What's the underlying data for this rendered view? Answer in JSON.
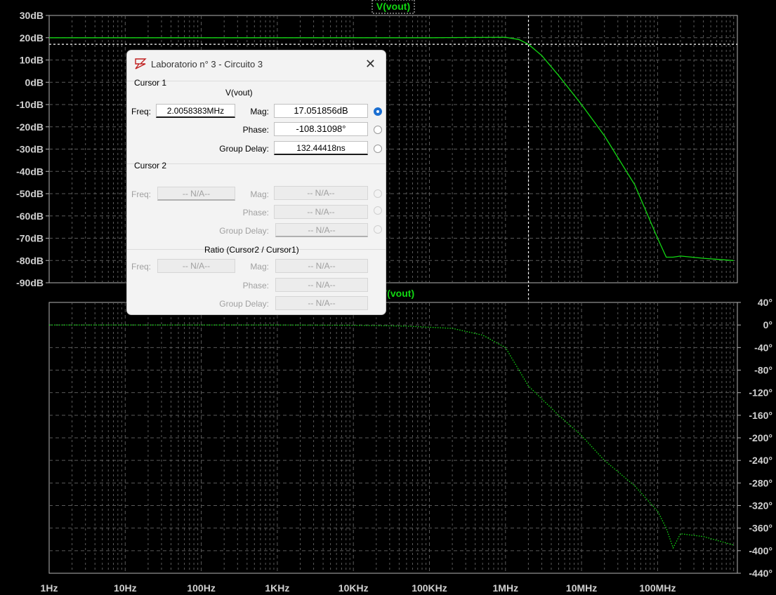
{
  "top_plot": {
    "trace_label": "V(vout)",
    "y_ticks": [
      "30dB",
      "20dB",
      "10dB",
      "0dB",
      "-10dB",
      "-20dB",
      "-30dB",
      "-40dB",
      "-50dB",
      "-60dB",
      "-70dB",
      "-80dB",
      "-90dB"
    ]
  },
  "bottom_plot": {
    "trace_label": "V(vout)",
    "y_ticks": [
      "40°",
      "0°",
      "-40°",
      "-80°",
      "-120°",
      "-160°",
      "-200°",
      "-240°",
      "-280°",
      "-320°",
      "-360°",
      "-400°",
      "-440°"
    ]
  },
  "x_ticks": [
    "1Hz",
    "10Hz",
    "100Hz",
    "1KHz",
    "10KHz",
    "100KHz",
    "1MHz",
    "10MHz",
    "100MHz"
  ],
  "colors": {
    "trace": "#12d812",
    "grid": "#5a5a5a",
    "axis": "#b4b4b4",
    "cursor": "#ffffff"
  },
  "chart_data": [
    {
      "type": "line",
      "title": "V(vout)",
      "x_scale": "log",
      "xlim": [
        "1Hz",
        "1GHz"
      ],
      "ylim": [
        -90,
        30
      ],
      "ylabel_unit": "dB",
      "series": [
        {
          "name": "V(vout)",
          "x": [
            1,
            10,
            100,
            1000,
            10000,
            100000,
            1000000,
            1500000,
            2000000,
            3000000,
            5000000,
            10000000,
            20000000,
            50000000,
            100000000,
            130000000,
            160000000,
            200000000,
            400000000,
            1000000000
          ],
          "y": [
            20,
            20,
            20,
            20,
            20,
            20,
            20.2,
            19.2,
            17.05,
            12,
            3,
            -10,
            -24,
            -46,
            -70,
            -78.5,
            -78.5,
            -78,
            -79,
            -80
          ]
        }
      ],
      "cursor": {
        "x": 2005838.3,
        "y": 17.051856
      }
    },
    {
      "type": "line",
      "title": "V(vout)",
      "x_scale": "log",
      "xlim": [
        "1Hz",
        "1GHz"
      ],
      "ylim": [
        -440,
        40
      ],
      "ylabel_unit": "°",
      "series": [
        {
          "name": "V(vout)",
          "x": [
            1,
            10,
            100,
            1000,
            10000,
            20000,
            50000,
            100000,
            200000,
            500000,
            1000000,
            2000000,
            5000000,
            10000000,
            20000000,
            50000000,
            100000000,
            130000000,
            160000000,
            200000000,
            400000000,
            1000000000
          ],
          "y": [
            0,
            0,
            0,
            0,
            -0.5,
            -1,
            -2,
            -4,
            -6,
            -18,
            -40,
            -108,
            -160,
            -196,
            -240,
            -285,
            -330,
            -360,
            -395,
            -370,
            -375,
            -390
          ]
        }
      ]
    }
  ],
  "dialog": {
    "title": "Laboratorio n° 3 - Circuito 3",
    "cursor1": {
      "section": "Cursor 1",
      "signal": "V(vout)",
      "freq_label": "Freq:",
      "freq": "2.0058383MHz",
      "mag_label": "Mag:",
      "mag": "17.051856dB",
      "phase_label": "Phase:",
      "phase": "-108.31098°",
      "gd_label": "Group Delay:",
      "gd": "132.44418ns"
    },
    "cursor2": {
      "section": "Cursor 2",
      "freq_label": "Freq:",
      "freq": "-- N/A--",
      "mag_label": "Mag:",
      "mag": "-- N/A--",
      "phase_label": "Phase:",
      "phase": "-- N/A--",
      "gd_label": "Group Delay:",
      "gd": "-- N/A--"
    },
    "ratio": {
      "section": "Ratio (Cursor2 / Cursor1)",
      "freq_label": "Freq:",
      "freq": "-- N/A--",
      "mag_label": "Mag:",
      "mag": "-- N/A--",
      "phase_label": "Phase:",
      "phase": "-- N/A--",
      "gd_label": "Group Delay:",
      "gd": "-- N/A--"
    }
  }
}
